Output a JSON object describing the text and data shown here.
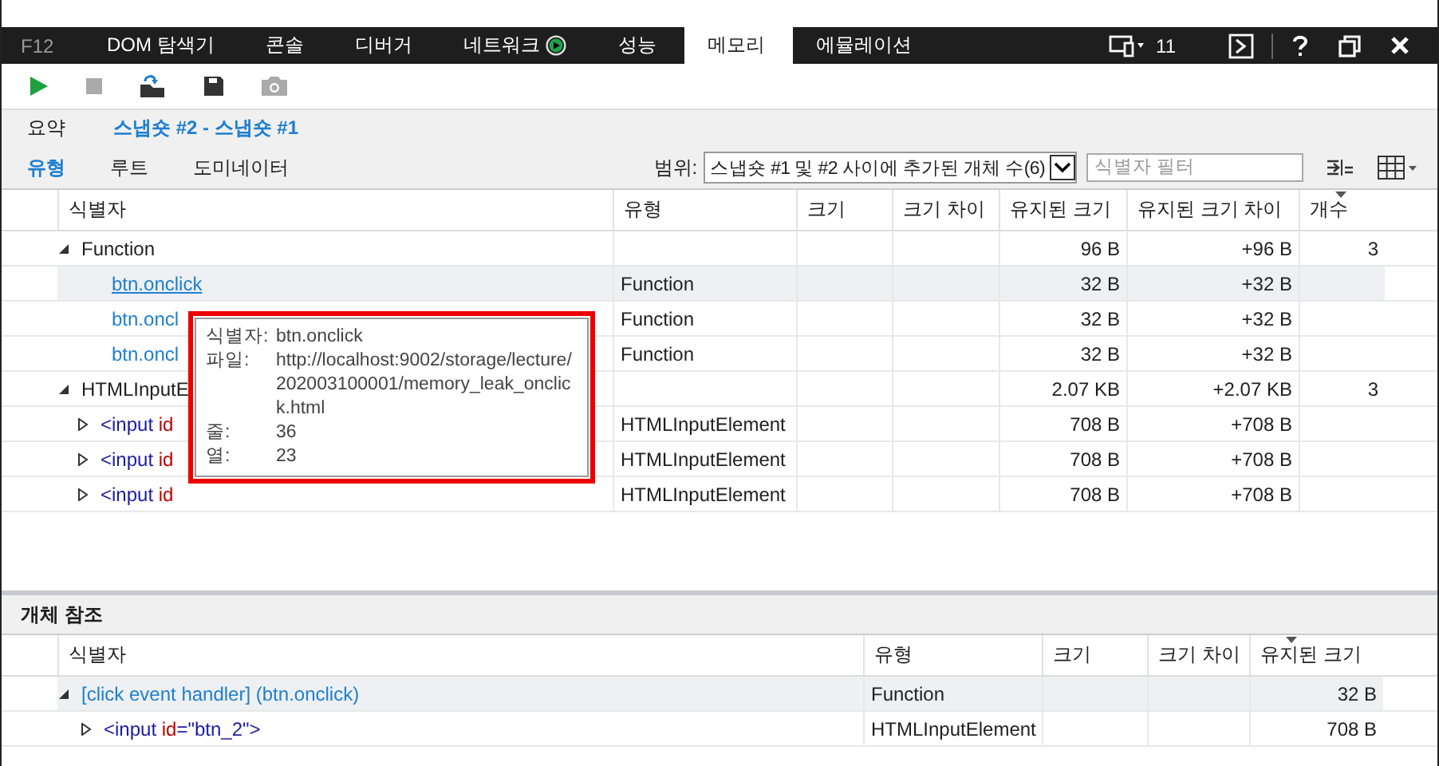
{
  "devtools": {
    "f12_label": "F12",
    "target_count": "11"
  },
  "tabs": [
    {
      "label": "DOM 탐색기",
      "selected": false,
      "kind": "plain"
    },
    {
      "label": "콘솔",
      "selected": false,
      "kind": "plain"
    },
    {
      "label": "디버거",
      "selected": false,
      "kind": "plain"
    },
    {
      "label": "네트워크",
      "selected": false,
      "kind": "recording"
    },
    {
      "label": "성능",
      "selected": false,
      "kind": "plain"
    },
    {
      "label": "메모리",
      "selected": true,
      "kind": "plain"
    },
    {
      "label": "에뮬레이션",
      "selected": false,
      "kind": "plain"
    }
  ],
  "toolbar": [
    {
      "kind": "start",
      "disabled": false
    },
    {
      "kind": "stop",
      "disabled": true
    },
    {
      "kind": "import",
      "disabled": false
    },
    {
      "kind": "save",
      "disabled": false
    },
    {
      "kind": "snapshot",
      "disabled": true
    }
  ],
  "summary": {
    "label": "요약",
    "breadcrumb": "스냅숏 #2 - 스냅숏 #1"
  },
  "views": [
    {
      "label": "유형",
      "selected": true
    },
    {
      "label": "루트",
      "selected": false
    },
    {
      "label": "도미네이터",
      "selected": false
    }
  ],
  "scope": {
    "label": "범위:",
    "value": "스냅숏 #1 및 #2 사이에 추가된 개체 수(6)"
  },
  "filter": {
    "placeholder": "식별자 필터"
  },
  "table": {
    "columns": [
      {
        "label": "식별자",
        "sorted": false
      },
      {
        "label": "유형",
        "sorted": false
      },
      {
        "label": "크기",
        "sorted": false
      },
      {
        "label": "크기 차이",
        "sorted": false
      },
      {
        "label": "유지된 크기",
        "sorted": false
      },
      {
        "label": "유지된 크기 차이",
        "sorted": false
      },
      {
        "label": "개수",
        "sorted": true
      }
    ],
    "rows": [
      {
        "kind": "group",
        "expanded": true,
        "selected": false,
        "identifier": "Function",
        "type": "",
        "retained": "96 B",
        "retained_diff": "+96 B",
        "count": "3"
      },
      {
        "kind": "link",
        "selected": true,
        "identifier": "btn.onclick",
        "type": "Function",
        "retained": "32 B",
        "retained_diff": "+32 B",
        "count": ""
      },
      {
        "kind": "link",
        "selected": false,
        "identifier": "btn.oncl",
        "type": "Function",
        "retained": "32 B",
        "retained_diff": "+32 B",
        "count": ""
      },
      {
        "kind": "link",
        "selected": false,
        "identifier": "btn.oncl",
        "type": "Function",
        "retained": "32 B",
        "retained_diff": "+32 B",
        "count": ""
      },
      {
        "kind": "group",
        "expanded": true,
        "selected": false,
        "identifier": "HTMLInputE",
        "type": "",
        "retained": "2.07 KB",
        "retained_diff": "+2.07 KB",
        "count": "3"
      },
      {
        "kind": "element",
        "expanded": false,
        "selected": false,
        "segments": [
          {
            "text": "<input",
            "kind": "tag"
          },
          {
            "text": "id",
            "kind": "attr"
          }
        ],
        "type": "HTMLInputElement",
        "retained": "708 B",
        "retained_diff": "+708 B",
        "count": ""
      },
      {
        "kind": "element",
        "expanded": false,
        "selected": false,
        "segments": [
          {
            "text": "<input",
            "kind": "tag"
          },
          {
            "text": "id",
            "kind": "attr"
          }
        ],
        "type": "HTMLInputElement",
        "retained": "708 B",
        "retained_diff": "+708 B",
        "count": ""
      },
      {
        "kind": "element",
        "expanded": false,
        "selected": false,
        "segments": [
          {
            "text": "<input",
            "kind": "tag"
          },
          {
            "text": "id",
            "kind": "attr"
          }
        ],
        "type": "HTMLInputElement",
        "retained": "708 B",
        "retained_diff": "+708 B",
        "count": ""
      }
    ]
  },
  "tooltip": [
    {
      "label": "식별자:",
      "value": "btn.onclick"
    },
    {
      "label": "파일:",
      "value": "http://localhost:9002/storage/lecture/202003100001/memory_leak_onclick.html"
    },
    {
      "label": "줄:",
      "value": "36"
    },
    {
      "label": "열:",
      "value": "23"
    }
  ],
  "references": {
    "title": "개체 참조",
    "columns": [
      {
        "label": "식별자",
        "sorted": false
      },
      {
        "label": "유형",
        "sorted": false
      },
      {
        "label": "크기",
        "sorted": false
      },
      {
        "label": "크기 차이",
        "sorted": false
      },
      {
        "label": "유지된 크기",
        "sorted": true
      }
    ],
    "rows": [
      {
        "kind": "link",
        "expanded": true,
        "selected": true,
        "identifier": "[click event handler] (btn.onclick)",
        "type": "Function",
        "retained": "32 B"
      },
      {
        "kind": "element",
        "expanded": false,
        "selected": false,
        "segments": [
          {
            "text": "<input",
            "kind": "tag"
          },
          {
            "text": "id",
            "kind": "attr"
          },
          {
            "text": "=",
            "kind": "punct"
          },
          {
            "text": "\"btn_2\"",
            "kind": "value"
          },
          {
            "text": ">",
            "kind": "tag"
          }
        ],
        "type": "HTMLInputElement",
        "retained": "708 B"
      }
    ]
  }
}
